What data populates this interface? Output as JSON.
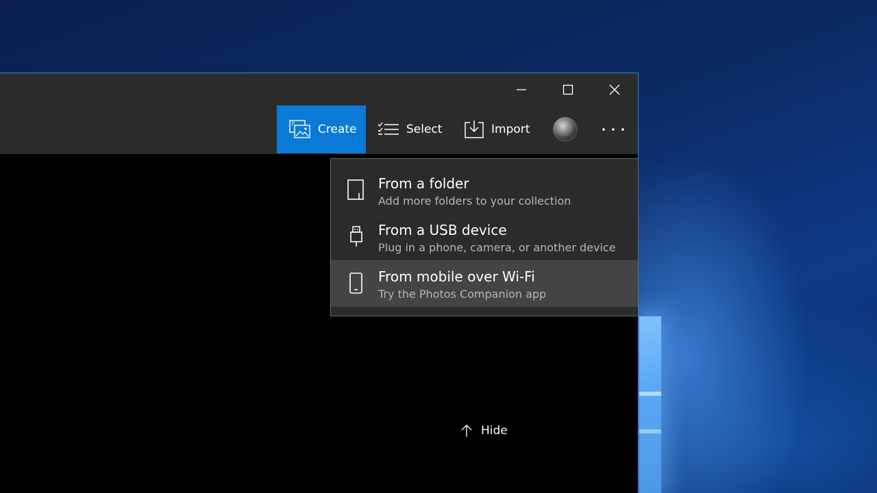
{
  "colors": {
    "accent": "#0a7ad6",
    "titlebar": "#2b2b2b",
    "menu_bg": "#2b2b2b",
    "menu_hover": "#444444",
    "content_bg": "#000000"
  },
  "window_controls": {
    "minimize_icon": "minimize-icon",
    "maximize_icon": "maximize-icon",
    "close_icon": "close-icon"
  },
  "toolbar": {
    "create_label": "Create",
    "select_label": "Select",
    "import_label": "Import",
    "more_label": "···"
  },
  "import_menu": {
    "items": [
      {
        "title": "From a folder",
        "subtitle": "Add more folders to your collection",
        "icon": "folder-icon"
      },
      {
        "title": "From a USB device",
        "subtitle": "Plug in a phone, camera, or another device",
        "icon": "usb-icon"
      },
      {
        "title": "From mobile over Wi-Fi",
        "subtitle": "Try the Photos Companion app",
        "icon": "mobile-phone-icon"
      }
    ]
  },
  "content": {
    "hide_label": "Hide"
  }
}
